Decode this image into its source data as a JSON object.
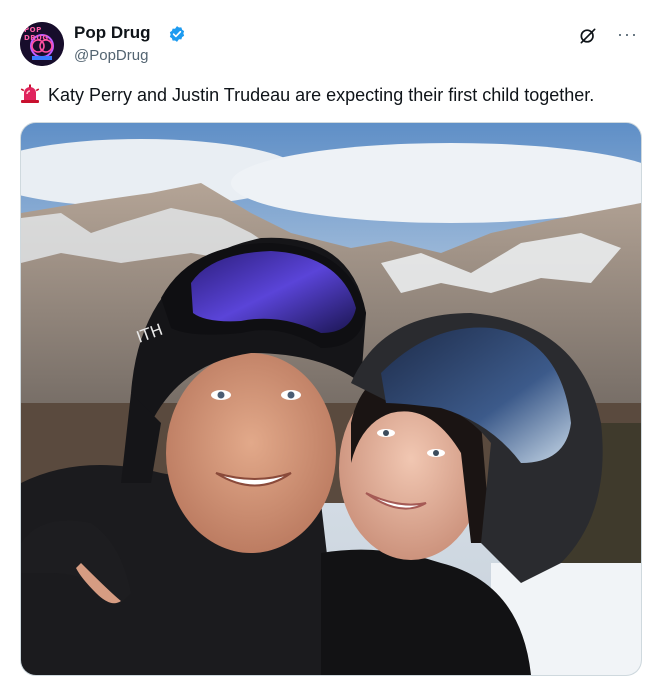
{
  "account": {
    "name": "Pop Drug",
    "handle": "@PopDrug",
    "avatar_text": "POP DRUG",
    "verified": true
  },
  "actions": {
    "grok_icon": "grok-icon",
    "more_icon": "more-dots-icon",
    "more_label": "···"
  },
  "post": {
    "emoji": "rotating-light-emoji",
    "text": "Katy Perry and Justin Trudeau are expecting their first child together."
  },
  "media": {
    "description_icon": "photo"
  },
  "colors": {
    "verified": "#1d9bf0",
    "handle": "#536471",
    "text": "#0f1419"
  }
}
